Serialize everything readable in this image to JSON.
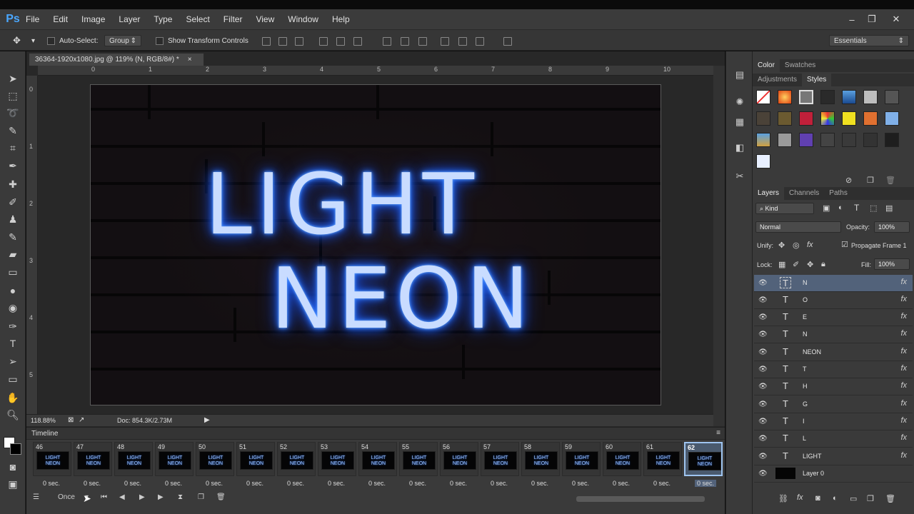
{
  "app": {
    "logo": "Ps"
  },
  "menu": [
    "File",
    "Edit",
    "Image",
    "Layer",
    "Type",
    "Select",
    "Filter",
    "View",
    "Window",
    "Help"
  ],
  "window_controls": {
    "minimize": "–",
    "restore": "❐",
    "close": "✕"
  },
  "options_bar": {
    "auto_select_label": "Auto-Select:",
    "auto_select_value": "Group",
    "transform_label": "Show Transform Controls",
    "workspace": "Essentials"
  },
  "document": {
    "tab_title": "36364-1920x1080.jpg @ 119% (N, RGB/8#) *",
    "tab_close": "×",
    "ruler_top": [
      "0",
      "1",
      "2",
      "3",
      "4",
      "5",
      "6",
      "7",
      "8",
      "9",
      "10"
    ],
    "ruler_left": [
      "0",
      "1",
      "2",
      "3",
      "4",
      "5"
    ],
    "canvas_text_line1": "LIGHT",
    "canvas_text_line2": "NEON",
    "zoom": "118.88%",
    "doc_size": "Doc: 854.3K/2.73M"
  },
  "timeline": {
    "title": "Timeline",
    "frames": [
      {
        "num": "46",
        "delay": "0 sec."
      },
      {
        "num": "47",
        "delay": "0 sec."
      },
      {
        "num": "48",
        "delay": "0 sec."
      },
      {
        "num": "49",
        "delay": "0 sec."
      },
      {
        "num": "50",
        "delay": "0 sec."
      },
      {
        "num": "51",
        "delay": "0 sec."
      },
      {
        "num": "52",
        "delay": "0 sec."
      },
      {
        "num": "53",
        "delay": "0 sec."
      },
      {
        "num": "54",
        "delay": "0 sec."
      },
      {
        "num": "55",
        "delay": "0 sec."
      },
      {
        "num": "56",
        "delay": "0 sec."
      },
      {
        "num": "57",
        "delay": "0 sec."
      },
      {
        "num": "58",
        "delay": "0 sec."
      },
      {
        "num": "59",
        "delay": "0 sec."
      },
      {
        "num": "60",
        "delay": "0 sec."
      },
      {
        "num": "61",
        "delay": "0 sec."
      },
      {
        "num": "62",
        "delay": "0 sec."
      }
    ],
    "thumb_line1": "LIGHT",
    "thumb_line2": "NEON",
    "loop": "Once"
  },
  "panels": {
    "color_tabs": [
      "Color",
      "Swatches"
    ],
    "style_tabs": [
      "Adjustments",
      "Styles"
    ],
    "layer_tabs": [
      "Layers",
      "Channels",
      "Paths"
    ],
    "kind_filter": "Kind",
    "blend_mode": "Normal",
    "opacity_label": "Opacity:",
    "opacity_value": "100%",
    "unify_label": "Unify:",
    "propagate_label": "Propagate Frame 1",
    "lock_label": "Lock:",
    "fill_label": "Fill:",
    "fill_value": "100%"
  },
  "layers": [
    {
      "name": "N",
      "type": "T",
      "fx": "fx"
    },
    {
      "name": "O",
      "type": "T",
      "fx": "fx"
    },
    {
      "name": "E",
      "type": "T",
      "fx": "fx"
    },
    {
      "name": "N",
      "type": "T",
      "fx": "fx"
    },
    {
      "name": "NEON",
      "type": "T",
      "fx": "fx"
    },
    {
      "name": "T",
      "type": "T",
      "fx": "fx"
    },
    {
      "name": "H",
      "type": "T",
      "fx": "fx"
    },
    {
      "name": "G",
      "type": "T",
      "fx": "fx"
    },
    {
      "name": "I",
      "type": "T",
      "fx": "fx"
    },
    {
      "name": "L",
      "type": "T",
      "fx": "fx"
    },
    {
      "name": "LIGHT",
      "type": "T",
      "fx": "fx"
    },
    {
      "name": "Layer 0",
      "type": "",
      "fx": ""
    }
  ],
  "colors": {
    "accent": "#4aa7ff",
    "selected_layer": "#52627a",
    "neon_glow": "#2f7bff"
  }
}
